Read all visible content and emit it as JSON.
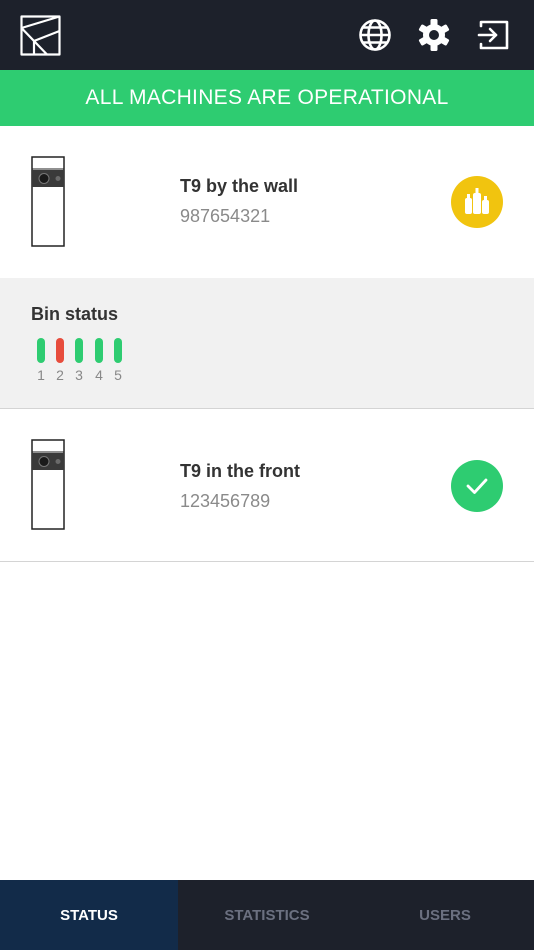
{
  "header": {
    "logo_icon": "logo-icon",
    "language_icon": "globe-icon",
    "settings_icon": "gear-icon",
    "logout_icon": "logout-icon"
  },
  "banner": {
    "text": "ALL MACHINES ARE OPERATIONAL",
    "color": "#2ecc71"
  },
  "machines": [
    {
      "name": "T9 by the wall",
      "serial": "987654321",
      "status_icon": "bottles-icon",
      "status_color": "#f1c40f"
    },
    {
      "name": "T9 in the front",
      "serial": "123456789",
      "status_icon": "check-icon",
      "status_color": "#2ecc71"
    }
  ],
  "bin_status": {
    "title": "Bin status",
    "bins": [
      {
        "label": "1",
        "color": "#2ecc71"
      },
      {
        "label": "2",
        "color": "#e74c3c"
      },
      {
        "label": "3",
        "color": "#2ecc71"
      },
      {
        "label": "4",
        "color": "#2ecc71"
      },
      {
        "label": "5",
        "color": "#2ecc71"
      }
    ]
  },
  "nav": {
    "tabs": [
      {
        "label": "STATUS",
        "active": true
      },
      {
        "label": "STATISTICS",
        "active": false
      },
      {
        "label": "USERS",
        "active": false
      }
    ]
  }
}
